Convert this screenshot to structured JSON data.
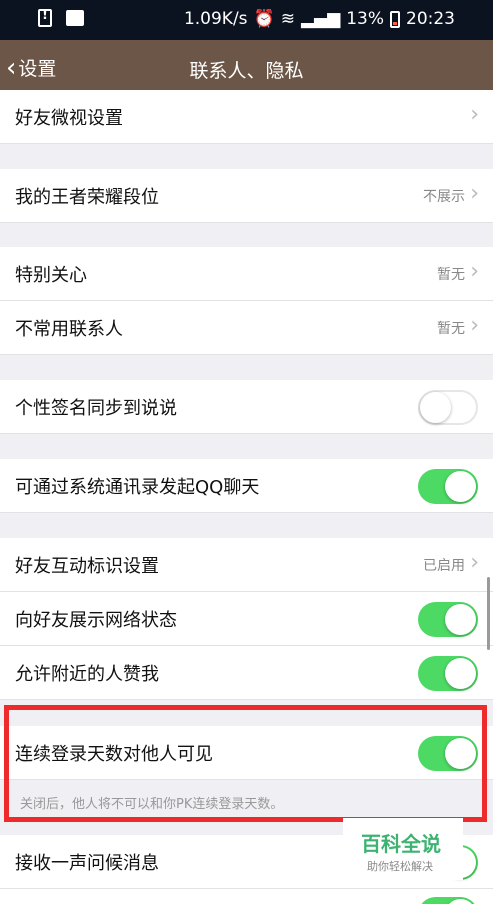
{
  "status_bar": {
    "speed": "1.09K/s",
    "battery": "13%",
    "time": "20:23",
    "icons": [
      "alert-icon",
      "image-icon",
      "alarm-icon",
      "wifi-icon",
      "signal-icon",
      "battery-icon"
    ]
  },
  "nav": {
    "back_label": "设置",
    "title": "联系人、隐私",
    "background": "#6b5647"
  },
  "rows": {
    "friends_micro_video": {
      "label": "好友微视设置"
    },
    "honor_rank": {
      "label": "我的王者荣耀段位",
      "value": "不展示"
    },
    "special_care": {
      "label": "特别关心",
      "value": "暂无"
    },
    "infrequent_contacts": {
      "label": "不常用联系人",
      "value": "暂无"
    },
    "signature_sync": {
      "label": "个性签名同步到说说",
      "toggle": false
    },
    "system_contacts_qq": {
      "label": "可通过系统通讯录发起QQ聊天",
      "toggle": true
    },
    "friend_interaction": {
      "label": "好友互动标识设置",
      "value": "已启用"
    },
    "show_network_status": {
      "label": "向好友展示网络状态",
      "toggle": true
    },
    "nearby_like": {
      "label": "允许附近的人赞我",
      "toggle": true
    },
    "login_days_visible": {
      "label": "连续登录天数对他人可见",
      "toggle": true
    },
    "receive_greeting": {
      "label": "接收一声问候消息",
      "toggle": true
    }
  },
  "hint_text": "关闭后，他人将不可以和你PK连续登录天数。",
  "watermark": {
    "title": "百科全说",
    "subtitle": "助你轻松解决"
  },
  "colors": {
    "toggle_on": "#4cd964",
    "highlight": "#ee2a2a",
    "watermark": "#3cb371"
  }
}
